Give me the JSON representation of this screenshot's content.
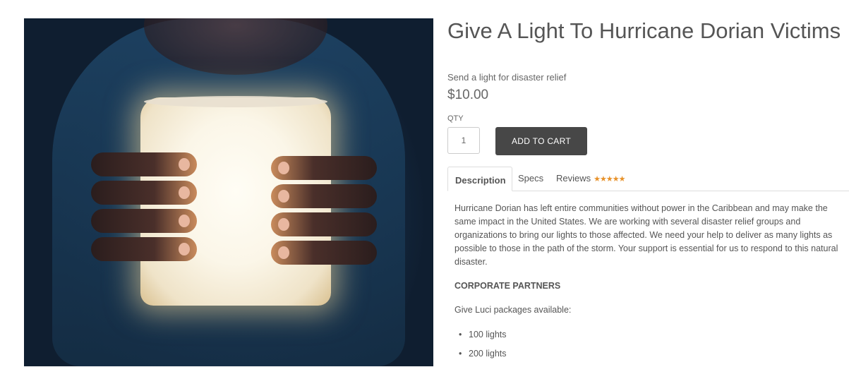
{
  "product": {
    "title": "Give A Light To Hurricane Dorian Victims",
    "subtitle": "Send a light for disaster relief",
    "price": "$10.00",
    "qty_label": "QTY",
    "qty_value": "1",
    "add_to_cart_label": "ADD TO CART"
  },
  "image": {
    "icon": "glowing-lantern-image"
  },
  "tabs": [
    {
      "label": "Description",
      "active": true
    },
    {
      "label": "Specs",
      "active": false
    },
    {
      "label": "Reviews",
      "active": false,
      "rating_stars": "★★★★★"
    }
  ],
  "description": {
    "paragraph": "Hurricane Dorian has left entire communities without power in the Caribbean and may make the same impact in the United States. We are working with several disaster relief groups and organizations to bring our lights to those affected. We need your help to deliver as many lights as possible to those in the path of the storm.  Your support is essential for us to respond to this natural disaster.",
    "heading": "CORPORATE PARTNERS",
    "packages_intro": "Give Luci packages available:",
    "packages": [
      "100 lights",
      "200 lights"
    ]
  },
  "colors": {
    "button_bg": "#474747",
    "star_color": "#e8922a",
    "text": "#555555"
  }
}
